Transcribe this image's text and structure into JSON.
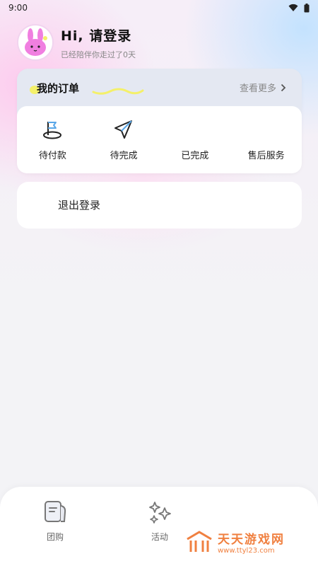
{
  "status_bar": {
    "time": "9:00"
  },
  "profile": {
    "greeting": "Hi, 请登录",
    "subtitle": "已经陪伴你走过了0天"
  },
  "orders": {
    "title": "我的订单",
    "more_label": "查看更多",
    "items": [
      {
        "label": "待付款",
        "icon": "flag-icon"
      },
      {
        "label": "待完成",
        "icon": "paper-plane-icon"
      },
      {
        "label": "已完成",
        "icon": ""
      },
      {
        "label": "售后服务",
        "icon": ""
      }
    ]
  },
  "logout": {
    "label": "退出登录"
  },
  "tabbar": {
    "items": [
      {
        "label": "团购",
        "icon": "notebook-icon"
      },
      {
        "label": "活动",
        "icon": "sparkle-icon"
      }
    ]
  },
  "watermark": {
    "title": "天天游戏网",
    "url": "www.ttyl23.com"
  },
  "colors": {
    "accent_yellow": "#f4f06a",
    "watermark_orange": "#f08040",
    "card_header": "#e4e8f2"
  }
}
